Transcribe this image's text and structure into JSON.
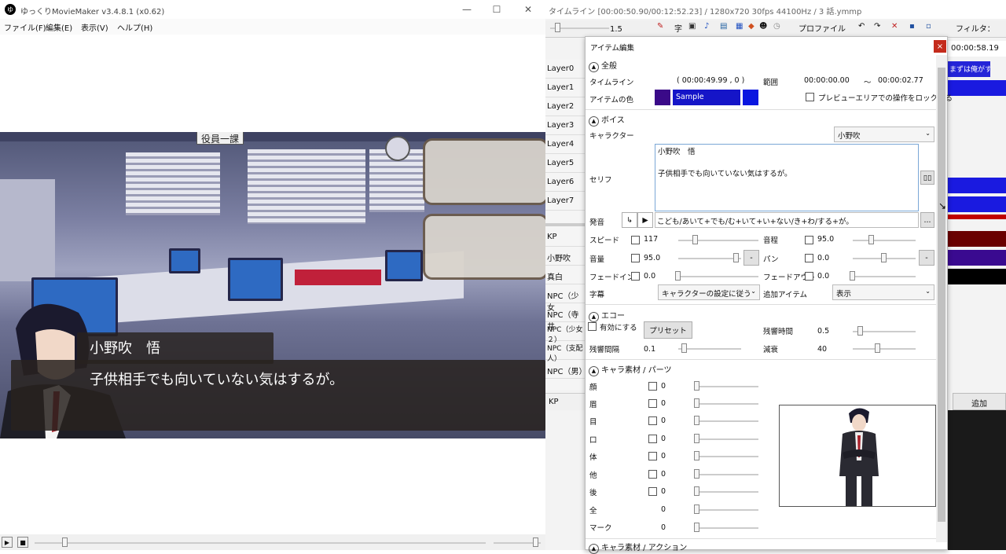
{
  "left_window": {
    "app_icon_text": "ゆ",
    "title": "ゆっくりMovieMaker v3.4.8.1 (x0.62)",
    "menu": [
      "ファイル(F)",
      "編集(E)",
      "表示(V)",
      "ヘルプ(H)"
    ],
    "preview": {
      "sign_text": "役員一課",
      "speaker_name": "小野吹　悟",
      "dialogue": "子供相手でも向いていない気はするが。"
    }
  },
  "timeline_window": {
    "title": "タイムライン [00:00:50.90/00:12:52.23] / 1280x720 30fps 44100Hz / 3 話.ymmp",
    "zoom_value": "1.5",
    "profile_label": "プロファイル",
    "filter_label": "フィルタ：",
    "time_readout": "00:00:58.19",
    "clip_text": "まずは俺がす",
    "layers": [
      "Layer0",
      "Layer1",
      "Layer2",
      "Layer3",
      "Layer4",
      "Layer5",
      "Layer6",
      "Layer7"
    ],
    "characters": [
      "KP",
      "小野吹",
      "真白",
      "NPC（少女",
      "NPC（寺井",
      "NPC（少女２）",
      "NPC（支配人）",
      "NPC（男）"
    ],
    "footer_kp": "KP",
    "footer_add": "追加"
  },
  "editor": {
    "title": "アイテム編集",
    "close": "×",
    "general": {
      "header": "全般",
      "timeline_label": "タイムライン",
      "timeline_value": "( 00:00:49.99 , 0 )",
      "range_label": "範囲",
      "range_start": "00:00:00.00",
      "range_sep": "〜",
      "range_end": "00:00:02.77",
      "color_label": "アイテムの色",
      "color_sample": "Sample",
      "lock_label": "プレビューエリアでの操作をロックする",
      "color_dark": "#3a0a88",
      "color_blue": "#0a16e0"
    },
    "voice": {
      "header": "ボイス",
      "character_label": "キャラクター",
      "character_value": "小野吹",
      "serif_label": "セリフ",
      "serif_line1": "小野吹　悟",
      "serif_line2": "子供相手でも向いていない気はするが。",
      "pron_label": "発音",
      "pron_value": "こども/あいて+でも/む+いて+い+ない/き+わ/する+が。",
      "more": "...",
      "speed_label": "スピード",
      "speed_value": "117",
      "pitch_label": "音程",
      "pitch_value": "95.0",
      "volume_label": "音量",
      "volume_value": "95.0",
      "pan_label": "パン",
      "pan_value": "0.0",
      "fadein_label": "フェードイン",
      "fadein_value": "0.0",
      "fadeout_label": "フェードアウト",
      "fadeout_value": "0.0",
      "subtitle_label": "字幕",
      "subtitle_value": "キャラクターの設定に従う",
      "additem_label": "追加アイテム",
      "additem_value": "表示",
      "minus": "-"
    },
    "echo": {
      "header": "エコー",
      "enable_label": "有効にする",
      "preset_button": "プリセット",
      "reverb_time_label": "残響時間",
      "reverb_time_value": "0.5",
      "interval_label": "残響間隔",
      "interval_value": "0.1",
      "decay_label": "減衰",
      "decay_value": "40"
    },
    "parts": {
      "header": "キャラ素材 / パーツ",
      "rows": [
        {
          "label": "顔",
          "value": "0"
        },
        {
          "label": "眉",
          "value": "0"
        },
        {
          "label": "目",
          "value": "0"
        },
        {
          "label": "口",
          "value": "0"
        },
        {
          "label": "体",
          "value": "0"
        },
        {
          "label": "他",
          "value": "0"
        },
        {
          "label": "後",
          "value": "0"
        },
        {
          "label": "全",
          "value": "0"
        },
        {
          "label": "マーク",
          "value": "0"
        }
      ]
    },
    "action_header": "キャラ素材 / アクション"
  }
}
